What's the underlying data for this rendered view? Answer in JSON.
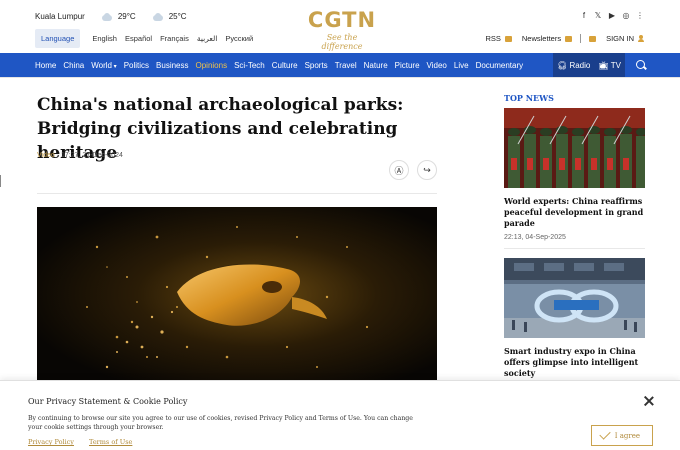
{
  "header": {
    "weather": {
      "city": "Kuala Lumpur",
      "temp1": "29°C",
      "temp2": "25°C"
    },
    "language_button": "Language",
    "languages": [
      "English",
      "Español",
      "Français",
      "العربية",
      "Русский"
    ],
    "logo": {
      "main": "CGTN",
      "tagline": "See the difference"
    },
    "account": {
      "rss": "RSS",
      "newsletters": "Newsletters",
      "sign_in": "SIGN IN"
    }
  },
  "nav": {
    "items": [
      "Home",
      "China",
      "World",
      "Politics",
      "Business",
      "Opinions",
      "Sci-Tech",
      "Culture",
      "Sports",
      "Travel",
      "Nature",
      "Picture",
      "Video",
      "Live",
      "Documentary"
    ],
    "active": "Opinions",
    "radio": "Radio",
    "tv": "TV"
  },
  "article": {
    "headline": "China's national archaeological parks: Bridging civilizations and celebrating heritage",
    "category": "Video",
    "timestamp": "17:27, 27-Dec-2024"
  },
  "sidebar": {
    "heading": "TOP NEWS",
    "news": [
      {
        "title": "World experts: China reaffirms peaceful development in grand parade",
        "time": "22:13, 04-Sep-2025"
      },
      {
        "title": "Smart industry expo in China offers glimpse into intelligent society",
        "time": ""
      }
    ]
  },
  "cookie": {
    "title": "Our Privacy Statement & Cookie Policy",
    "text": "By continuing to browse our site you agree to our use of cookies, revised Privacy Policy and Terms of Use. You can change your cookie settings through your browser.",
    "privacy_link": "Privacy Policy",
    "terms_link": "Terms of Use",
    "agree": "I agree"
  },
  "colors": {
    "nav_blue": "#1f56c4",
    "gold": "#c9a24d",
    "active_nav": "#f0c34a"
  }
}
